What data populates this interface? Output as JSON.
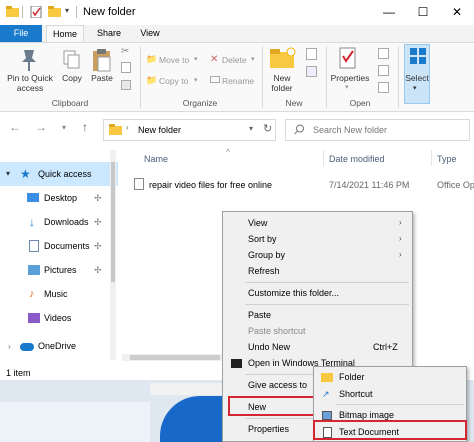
{
  "window": {
    "title": "New folder",
    "controls": {
      "minimize": "—",
      "maximize": "☐",
      "close": "✕"
    }
  },
  "ribbon_tabs": [
    "File",
    "Home",
    "Share",
    "View"
  ],
  "ribbon": {
    "pin_label": "Pin to Quick access",
    "copy_label": "Copy",
    "paste_label": "Paste",
    "move_to_label": "Move to",
    "copy_to_label": "Copy to",
    "delete_label": "Delete",
    "rename_label": "Rename",
    "new_folder_label": "New folder",
    "properties_label": "Properties",
    "select_label": "Select",
    "groups": {
      "clipboard": "Clipboard",
      "organize": "Organize",
      "new": "New",
      "open": "Open"
    }
  },
  "address": {
    "path": "New folder",
    "search_placeholder": "Search New folder"
  },
  "nav_pane": {
    "quick_access": "Quick access",
    "items": [
      "Desktop",
      "Downloads",
      "Documents",
      "Pictures",
      "Music",
      "Videos"
    ],
    "onedrive": "OneDrive"
  },
  "columns": {
    "name": "Name",
    "date": "Date modified",
    "type": "Type"
  },
  "files": [
    {
      "name": "repair video files for free online",
      "date": "7/14/2021 11:46 PM",
      "type": "Office Op"
    }
  ],
  "status": {
    "count": "1 item"
  },
  "context_menu": {
    "items": [
      "View",
      "Sort by",
      "Group by",
      "Refresh",
      "Customize this folder...",
      "Paste",
      "Paste shortcut",
      "Undo New",
      "Open in Windows Terminal",
      "Give access to",
      "New",
      "Properties"
    ],
    "undo_shortcut": "Ctrl+Z"
  },
  "submenu": {
    "items": [
      "Folder",
      "Shortcut",
      "Bitmap image",
      "Text Document"
    ]
  },
  "colors": {
    "accent": "#1979ca",
    "highlight_red": "#d22630",
    "folder": "#f8c840"
  }
}
